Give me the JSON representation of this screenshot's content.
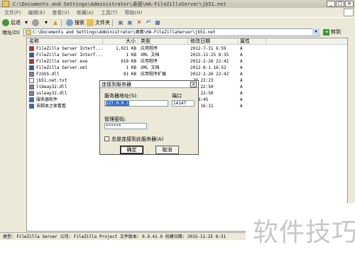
{
  "window": {
    "title": "C:\\Documents and Settings\\Administrator\\桌面\\HA-FileZillaServer\\jb51.net"
  },
  "menu": [
    "文件(F)",
    "编辑(E)",
    "查看(V)",
    "收藏(A)",
    "工具(T)",
    "帮助(H)"
  ],
  "toolbar": {
    "back": "后退",
    "search": "搜索",
    "folders": "文件夹"
  },
  "address": {
    "label": "地址(D)",
    "value": "C:\\Documents and Settings\\Administrator\\桌面\\HA-FileZillaServer\\jb51.net",
    "go": "转到"
  },
  "columns": {
    "name": "名称",
    "size": "大小",
    "type": "类型",
    "modified": "修改日期",
    "attr": "属性"
  },
  "files": [
    {
      "name": "FileZilla Server Interf...",
      "size": "1,021 KB",
      "type": "应用程序",
      "modified": "2012-7-31 6:59",
      "attr": "A",
      "icon": "filezilla-icon",
      "color": "#c03020"
    },
    {
      "name": "FileZilla Server Interf...",
      "size": "1 KB",
      "type": "XML 文档",
      "modified": "2015-11-25 8:35",
      "attr": "A",
      "icon": "xml-icon",
      "color": "#3060a0"
    },
    {
      "name": "FileZilla server.exe",
      "size": "618 KB",
      "type": "应用程序",
      "modified": "2012-2-26 22:42",
      "attr": "A",
      "icon": "filezilla-icon",
      "color": "#c03020"
    },
    {
      "name": "FileZilla Server.xml",
      "size": "1 KB",
      "type": "XML 文档",
      "modified": "2012-8-1 16:52",
      "attr": "A",
      "icon": "xml-icon",
      "color": "#3060a0"
    },
    {
      "name": "FzGSS.dll",
      "size": "81 KB",
      "type": "应用程序扩展",
      "modified": "2012-2-26 22:42",
      "attr": "A",
      "icon": "dll-icon",
      "color": "#8080a0"
    },
    {
      "name": "jb51.net.txt",
      "size": "",
      "type": "",
      "modified": "-29 22:23",
      "attr": "A",
      "icon": "txt-icon",
      "color": "#ffffff"
    },
    {
      "name": "libeay32.dll",
      "size": "",
      "type": "",
      "modified": "-26 22:50",
      "attr": "A",
      "icon": "dll-icon",
      "color": "#8080a0"
    },
    {
      "name": "ssleay32.dll",
      "size": "",
      "type": "",
      "modified": "-26 22:50",
      "attr": "A",
      "icon": "dll-icon",
      "color": "#8080a0"
    },
    {
      "name": "服务器软件",
      "size": "",
      "type": "",
      "modified": "-6 8:45",
      "attr": "A",
      "icon": "shortcut-icon",
      "color": "#3070c0"
    },
    {
      "name": "去脚本之家看看",
      "size": "",
      "type": "",
      "modified": "-24 16:11",
      "attr": "A",
      "icon": "shortcut-icon",
      "color": "#3070c0"
    }
  ],
  "dialog": {
    "title": "连接到服务器",
    "address_label": "服务器地址(S):",
    "address_value": "127.0.0.1",
    "port_label": "端口",
    "port_value": "14147",
    "password_label": "管理密码:",
    "password_value": "******",
    "checkbox_label": "总是连接到此服务器(A)",
    "ok": "确定",
    "cancel": "取消"
  },
  "status": "类型: FileZilla Server 公司: FileZilla Project 文件版本: 0.9.41.0 创建日期: 2015-11-25 8:31",
  "watermark": "软件技巧"
}
